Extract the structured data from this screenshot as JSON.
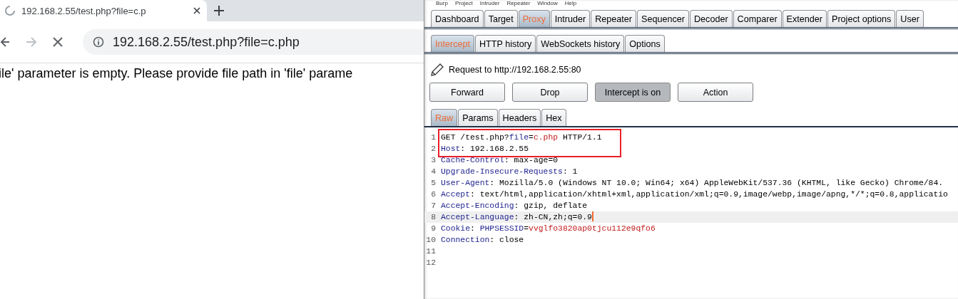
{
  "browser": {
    "tab": {
      "title": "192.168.2.55/test.php?file=c.p",
      "loading": true
    },
    "toolbar": {
      "forward_disabled": true,
      "loading": true
    },
    "address": "192.168.2.55/test.php?file=c.php",
    "page_text": "ile' parameter is empty. Please provide file path in 'file' parame"
  },
  "burp": {
    "menu": [
      "Burp",
      "Project",
      "Intruder",
      "Repeater",
      "Window",
      "Help"
    ],
    "tabs": [
      {
        "label": "Dashboard",
        "selected": false
      },
      {
        "label": "Target",
        "selected": false
      },
      {
        "label": "Proxy",
        "selected": true
      },
      {
        "label": "Intruder",
        "selected": false
      },
      {
        "label": "Repeater",
        "selected": false
      },
      {
        "label": "Sequencer",
        "selected": false
      },
      {
        "label": "Decoder",
        "selected": false
      },
      {
        "label": "Comparer",
        "selected": false
      },
      {
        "label": "Extender",
        "selected": false
      },
      {
        "label": "Project options",
        "selected": false
      },
      {
        "label": "User",
        "selected": false
      }
    ],
    "subtabs": [
      {
        "label": "Intercept",
        "selected": true
      },
      {
        "label": "HTTP history",
        "selected": false
      },
      {
        "label": "WebSockets history",
        "selected": false
      },
      {
        "label": "Options",
        "selected": false
      }
    ],
    "request_label": "Request to http://192.168.2.55:80",
    "buttons": [
      {
        "label": "Forward",
        "pressed": false
      },
      {
        "label": "Drop",
        "pressed": false
      },
      {
        "label": "Intercept is on",
        "pressed": true
      },
      {
        "label": "Action",
        "pressed": false
      }
    ],
    "editor_tabs": [
      {
        "label": "Raw",
        "selected": true
      },
      {
        "label": "Params",
        "selected": false
      },
      {
        "label": "Headers",
        "selected": false
      },
      {
        "label": "Hex",
        "selected": false
      }
    ],
    "lines": [
      {
        "number": "1",
        "annotated": true,
        "current": false,
        "segments": [
          {
            "kind": "plain",
            "text": "GET /test.php?"
          },
          {
            "kind": "name",
            "text": "file"
          },
          {
            "kind": "plain",
            "text": "="
          },
          {
            "kind": "value",
            "text": "c.php"
          },
          {
            "kind": "plain",
            "text": " HTTP/1.1"
          }
        ]
      },
      {
        "number": "2",
        "annotated": true,
        "current": false,
        "segments": [
          {
            "kind": "name",
            "text": "Host"
          },
          {
            "kind": "plain",
            "text": ": 192.168.2.55"
          }
        ]
      },
      {
        "number": "3",
        "annotated": false,
        "current": false,
        "segments": [
          {
            "kind": "name",
            "text": "Cache-Control"
          },
          {
            "kind": "plain",
            "text": ": max-age=0"
          }
        ]
      },
      {
        "number": "4",
        "annotated": false,
        "current": false,
        "segments": [
          {
            "kind": "name",
            "text": "Upgrade-Insecure-Requests"
          },
          {
            "kind": "plain",
            "text": ": 1"
          }
        ]
      },
      {
        "number": "5",
        "annotated": false,
        "current": false,
        "segments": [
          {
            "kind": "name",
            "text": "User-Agent"
          },
          {
            "kind": "plain",
            "text": ": Mozilla/5.0 (Windows NT 10.0; Win64; x64) AppleWebKit/537.36 (KHTML, like Gecko) Chrome/84."
          }
        ]
      },
      {
        "number": "6",
        "annotated": false,
        "current": false,
        "segments": [
          {
            "kind": "name",
            "text": "Accept"
          },
          {
            "kind": "plain",
            "text": ": text/html,application/xhtml+xml,application/xml;q=0.9,image/webp,image/apng,*/*;q=0.8,applicatio"
          }
        ]
      },
      {
        "number": "7",
        "annotated": false,
        "current": false,
        "segments": [
          {
            "kind": "name",
            "text": "Accept-Encoding"
          },
          {
            "kind": "plain",
            "text": ": gzip, deflate"
          }
        ]
      },
      {
        "number": "8",
        "annotated": false,
        "current": true,
        "segments": [
          {
            "kind": "name",
            "text": "Accept-Language"
          },
          {
            "kind": "plain",
            "text": ": zh-CN,zh;q=0.9"
          }
        ]
      },
      {
        "number": "9",
        "annotated": false,
        "current": false,
        "segments": [
          {
            "kind": "name",
            "text": "Cookie"
          },
          {
            "kind": "plain",
            "text": ": "
          },
          {
            "kind": "name",
            "text": "PHPSESSID"
          },
          {
            "kind": "plain",
            "text": "="
          },
          {
            "kind": "value",
            "text": "vvglfo3820ap0tjcu112e9qfo6"
          }
        ]
      },
      {
        "number": "10",
        "annotated": false,
        "current": false,
        "segments": [
          {
            "kind": "name",
            "text": "Connection"
          },
          {
            "kind": "plain",
            "text": ": close"
          }
        ]
      },
      {
        "number": "11",
        "annotated": false,
        "current": false
      },
      {
        "number": "12",
        "annotated": false,
        "current": false
      }
    ]
  }
}
